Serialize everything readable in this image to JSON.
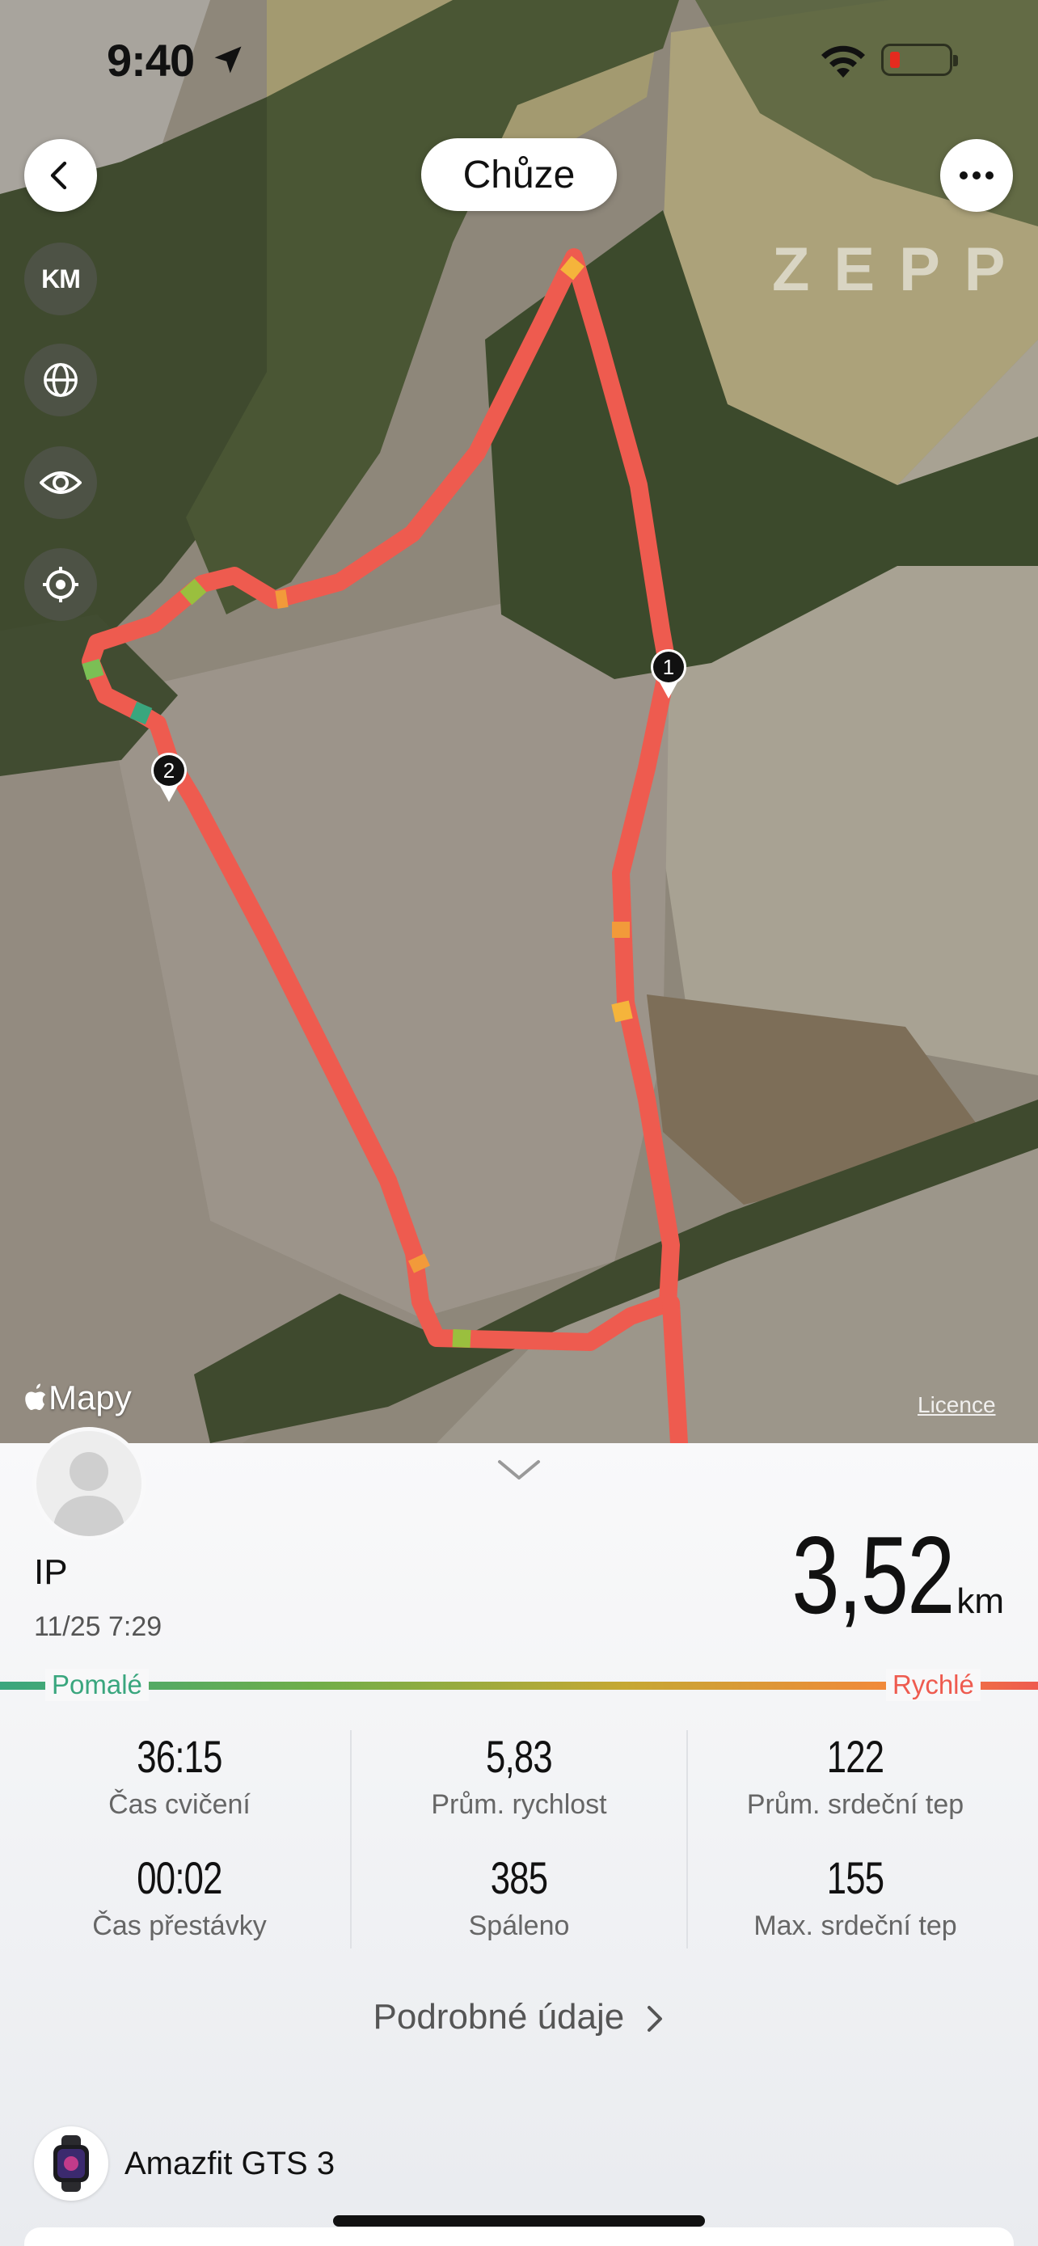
{
  "status_bar": {
    "time": "9:40",
    "battery_level": 0.1,
    "battery_color": "#e52b1f"
  },
  "header": {
    "title": "Chůze"
  },
  "map": {
    "side_controls": {
      "unit_toggle": "KM"
    },
    "watermark": "ZEPP",
    "attribution": "Mapy",
    "licence": "Licence",
    "markers": [
      "1",
      "2"
    ],
    "route_color": "#ee5b4f"
  },
  "summary": {
    "user_name": "IP",
    "date_time": "11/25 7:29",
    "distance_value": "3,52",
    "distance_unit": "km"
  },
  "pace_scale": {
    "slow_label": "Pomalé",
    "fast_label": "Rychlé",
    "slow_color": "#3aa67e",
    "fast_color": "#ee5b4f"
  },
  "stats": [
    {
      "value": "36:15",
      "label": "Čas cvičení"
    },
    {
      "value": "5,83",
      "label": "Prům. rychlost"
    },
    {
      "value": "122",
      "label": "Prům. srdeční tep"
    },
    {
      "value": "00:02",
      "label": "Čas přestávky"
    },
    {
      "value": "385",
      "label": "Spáleno"
    },
    {
      "value": "155",
      "label": "Max. srdeční tep"
    }
  ],
  "details_link": "Podrobné údaje",
  "device": {
    "name": "Amazfit GTS 3"
  }
}
